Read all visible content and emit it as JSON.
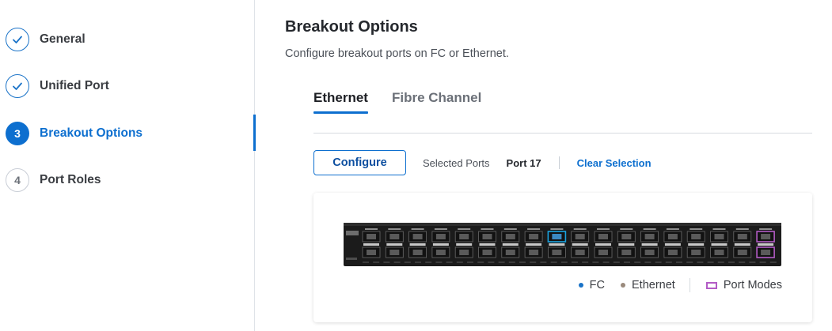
{
  "wizard": {
    "steps": [
      {
        "number": "",
        "label": "General",
        "state": "done",
        "icon": "check-icon"
      },
      {
        "number": "",
        "label": "Unified Port",
        "state": "done",
        "icon": "check-icon"
      },
      {
        "number": "3",
        "label": "Breakout Options",
        "state": "current"
      },
      {
        "number": "4",
        "label": "Port Roles",
        "state": "pending"
      }
    ]
  },
  "main": {
    "title": "Breakout Options",
    "subtitle": "Configure breakout ports on FC or Ethernet.",
    "tabs": [
      {
        "label": "Ethernet",
        "active": true
      },
      {
        "label": "Fibre Channel",
        "active": false
      }
    ],
    "toolbar": {
      "configure_label": "Configure",
      "selected_ports_label": "Selected Ports",
      "selected_ports_value": "Port 17",
      "clear_label": "Clear Selection"
    },
    "legend": {
      "fc_label": "FC",
      "ethernet_label": "Ethernet",
      "port_modes_label": "Port Modes"
    },
    "switch": {
      "selected_port": 17,
      "port_pairs": 18,
      "port_mode_columns": [
        18
      ],
      "uplink_columns": 1
    }
  },
  "colors": {
    "accent": "#0d6fcf",
    "fc": "#1a73c8",
    "ethernet": "#9a8a7c",
    "port_modes": "#b35cc6",
    "selected_port": "#1aa3e0"
  }
}
